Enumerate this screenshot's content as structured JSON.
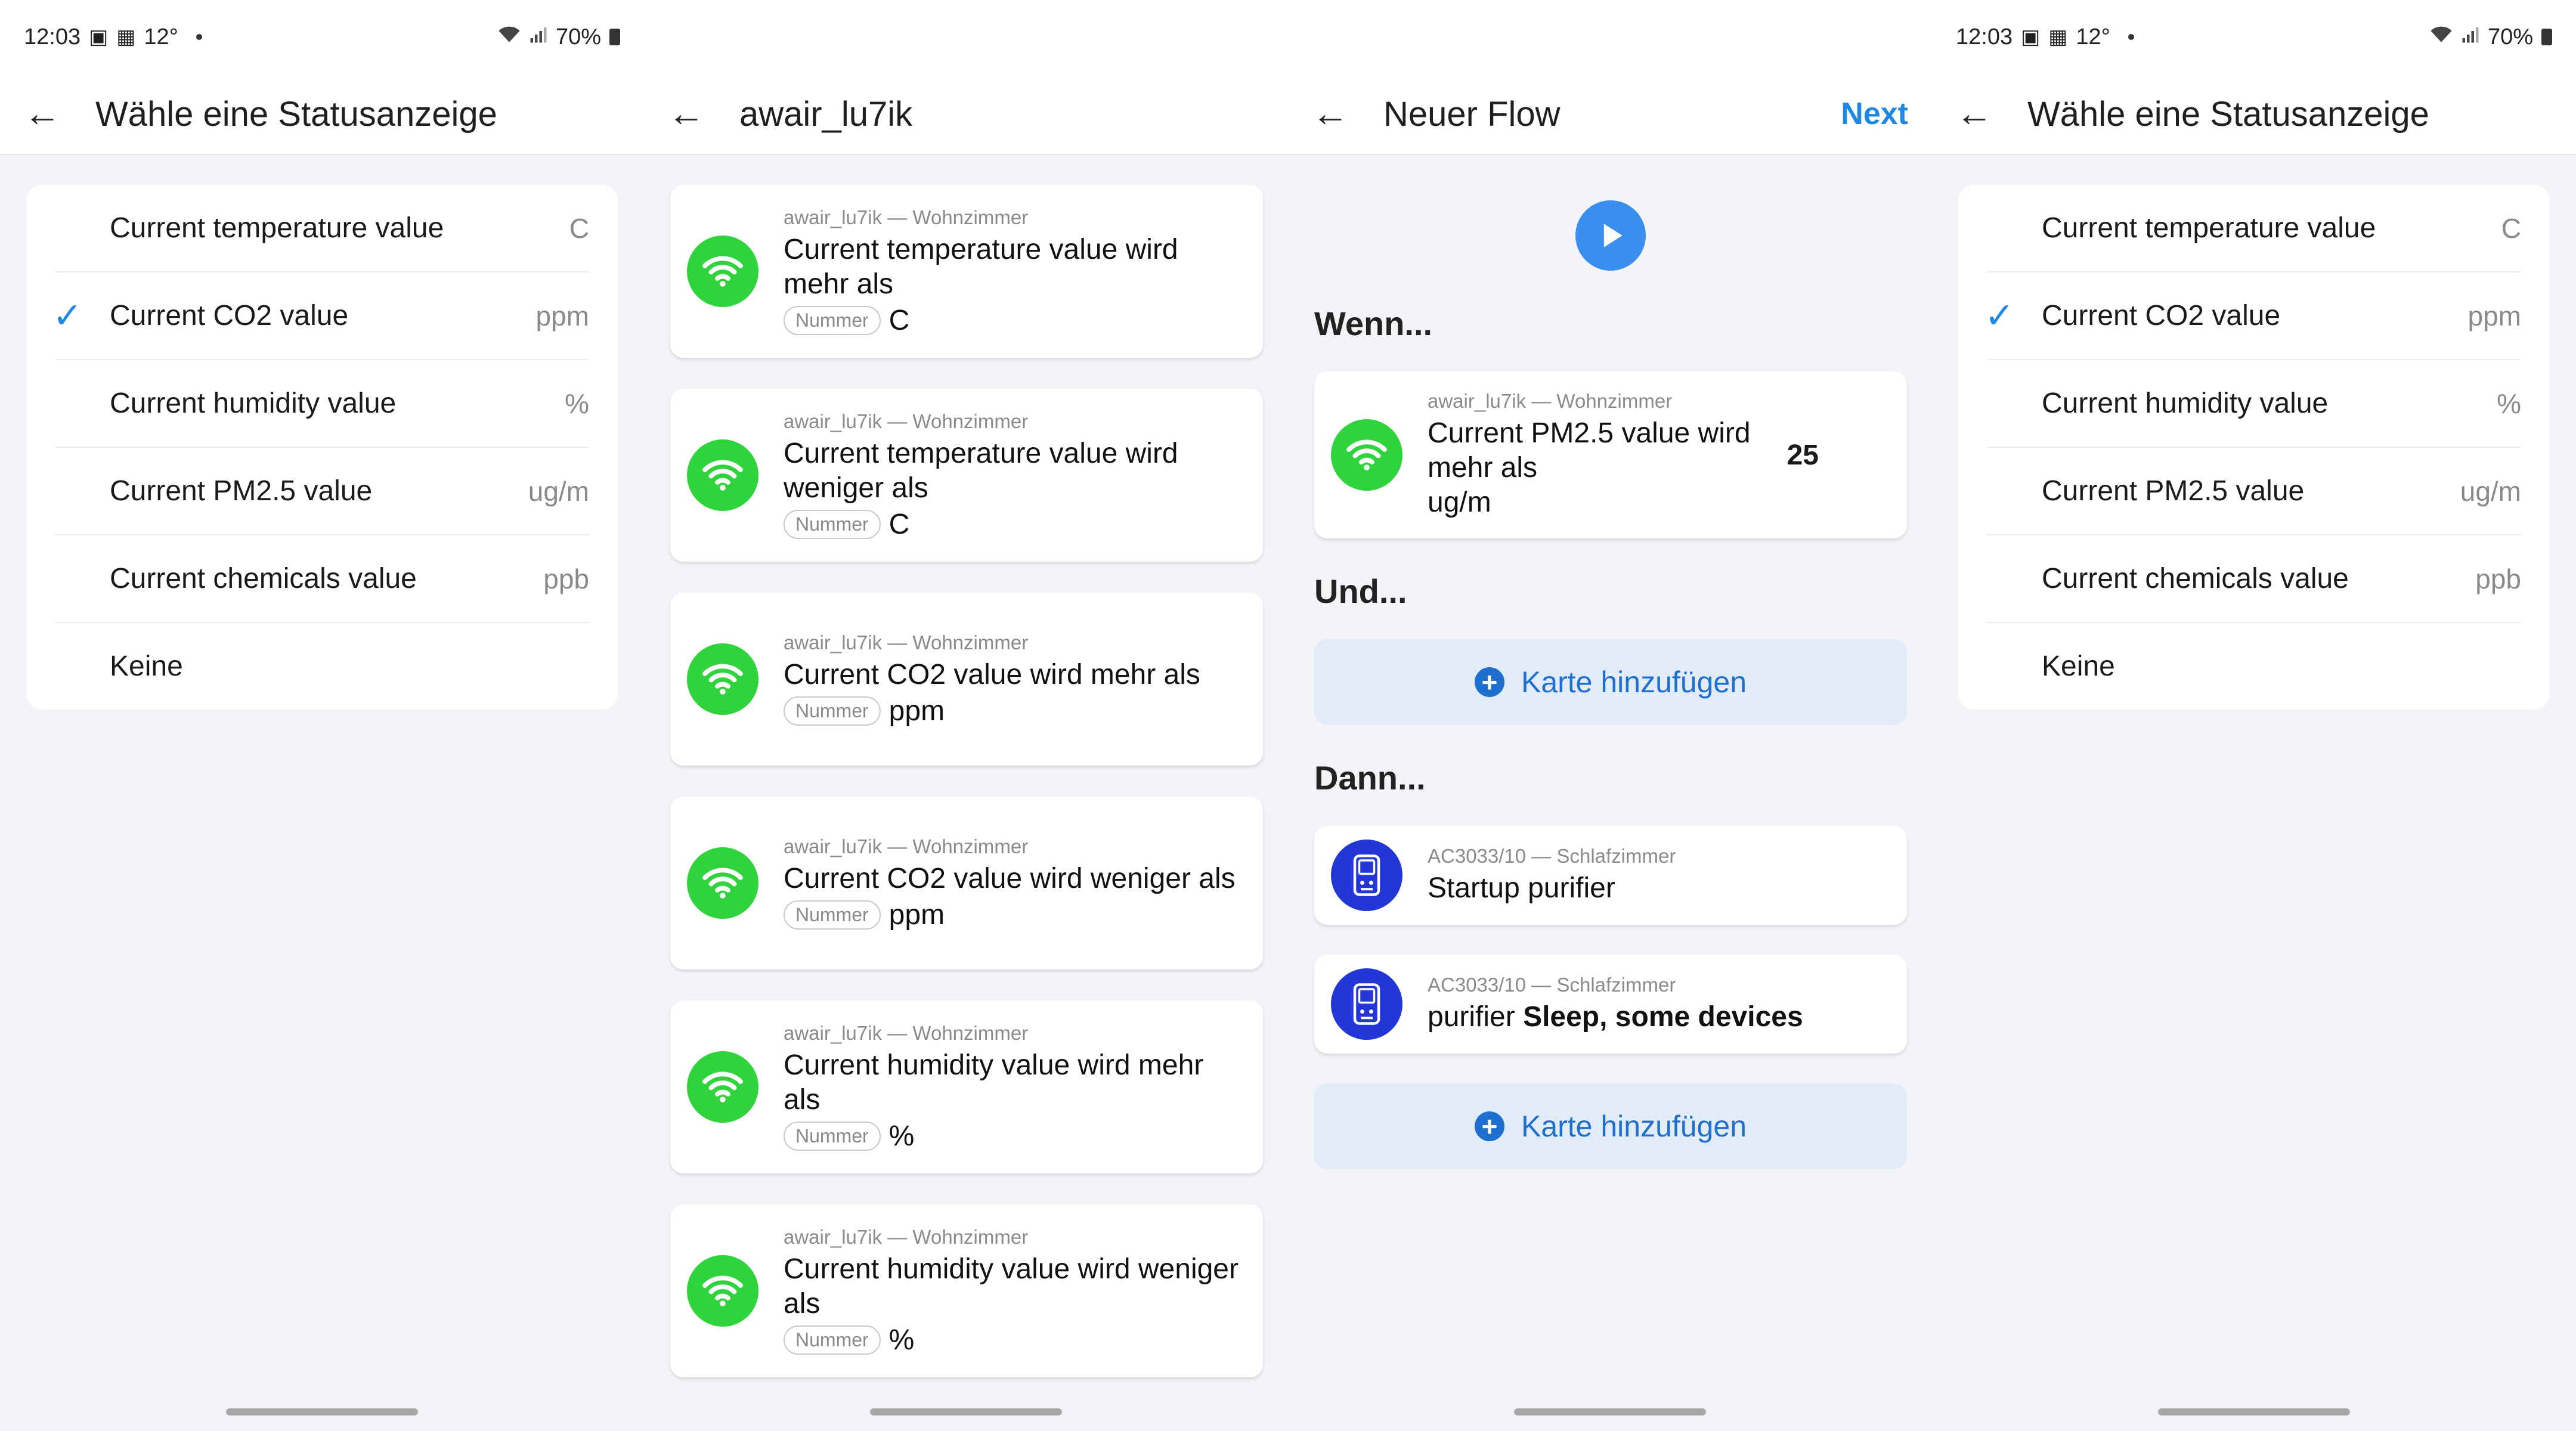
{
  "status": {
    "time": "12:03",
    "temp": "12°",
    "battery": "70%"
  },
  "screen1": {
    "title": "Wähle eine Statusanzeige",
    "items": [
      {
        "label": "Current temperature value",
        "unit": "C",
        "checked": false
      },
      {
        "label": "Current CO2 value",
        "unit": "ppm",
        "checked": true
      },
      {
        "label": "Current humidity value",
        "unit": "%",
        "checked": false
      },
      {
        "label": "Current PM2.5 value",
        "unit": "ug/m",
        "checked": false
      },
      {
        "label": "Current chemicals value",
        "unit": "ppb",
        "checked": false
      },
      {
        "label": "Keine",
        "unit": "",
        "checked": false
      }
    ]
  },
  "screen2": {
    "title": "awair_lu7ik",
    "cards": [
      {
        "meta": "awair_lu7ik — Wohnzimmer",
        "name": "Current temperature value wird mehr als",
        "pill": "Nummer",
        "unit": "C"
      },
      {
        "meta": "awair_lu7ik — Wohnzimmer",
        "name": "Current temperature value wird weniger als",
        "pill": "Nummer",
        "unit": "C"
      },
      {
        "meta": "awair_lu7ik — Wohnzimmer",
        "name": "Current CO2 value wird mehr als",
        "pill": "Nummer",
        "unit": "ppm"
      },
      {
        "meta": "awair_lu7ik — Wohnzimmer",
        "name": "Current CO2 value wird weniger als",
        "pill": "Nummer",
        "unit": "ppm"
      },
      {
        "meta": "awair_lu7ik — Wohnzimmer",
        "name": "Current humidity value wird mehr als",
        "pill": "Nummer",
        "unit": "%"
      },
      {
        "meta": "awair_lu7ik — Wohnzimmer",
        "name": "Current humidity value wird weniger als",
        "pill": "Nummer",
        "unit": "%"
      }
    ]
  },
  "screen3": {
    "title": "Neuer Flow",
    "next": "Next",
    "when_label": "Wenn...",
    "when_card": {
      "meta": "awair_lu7ik — Wohnzimmer",
      "name": "Current PM2.5 value wird mehr als",
      "unit": "ug/m",
      "value": "25"
    },
    "and_label": "Und...",
    "add_card": "Karte hinzufügen",
    "then_label": "Dann...",
    "then_cards": [
      {
        "meta": "AC3033/10 — Schlafzimmer",
        "name_plain": "Startup purifier",
        "name_bold": ""
      },
      {
        "meta": "AC3033/10 — Schlafzimmer",
        "name_plain": "purifier",
        "name_bold": "Sleep, some devices"
      }
    ],
    "add_card_2": "Karte hinzufügen"
  },
  "screen4": {
    "title": "Wähle eine Statusanzeige",
    "items": [
      {
        "label": "Current temperature value",
        "unit": "C",
        "checked": false
      },
      {
        "label": "Current CO2 value",
        "unit": "ppm",
        "checked": true
      },
      {
        "label": "Current humidity value",
        "unit": "%",
        "checked": false
      },
      {
        "label": "Current PM2.5 value",
        "unit": "ug/m",
        "checked": false
      },
      {
        "label": "Current chemicals value",
        "unit": "ppb",
        "checked": false
      },
      {
        "label": "Keine",
        "unit": "",
        "checked": false
      }
    ]
  },
  "colors": {
    "accent": "#1e88e5",
    "wifi_green": "#2fd43c",
    "device_blue": "#2237d6"
  }
}
